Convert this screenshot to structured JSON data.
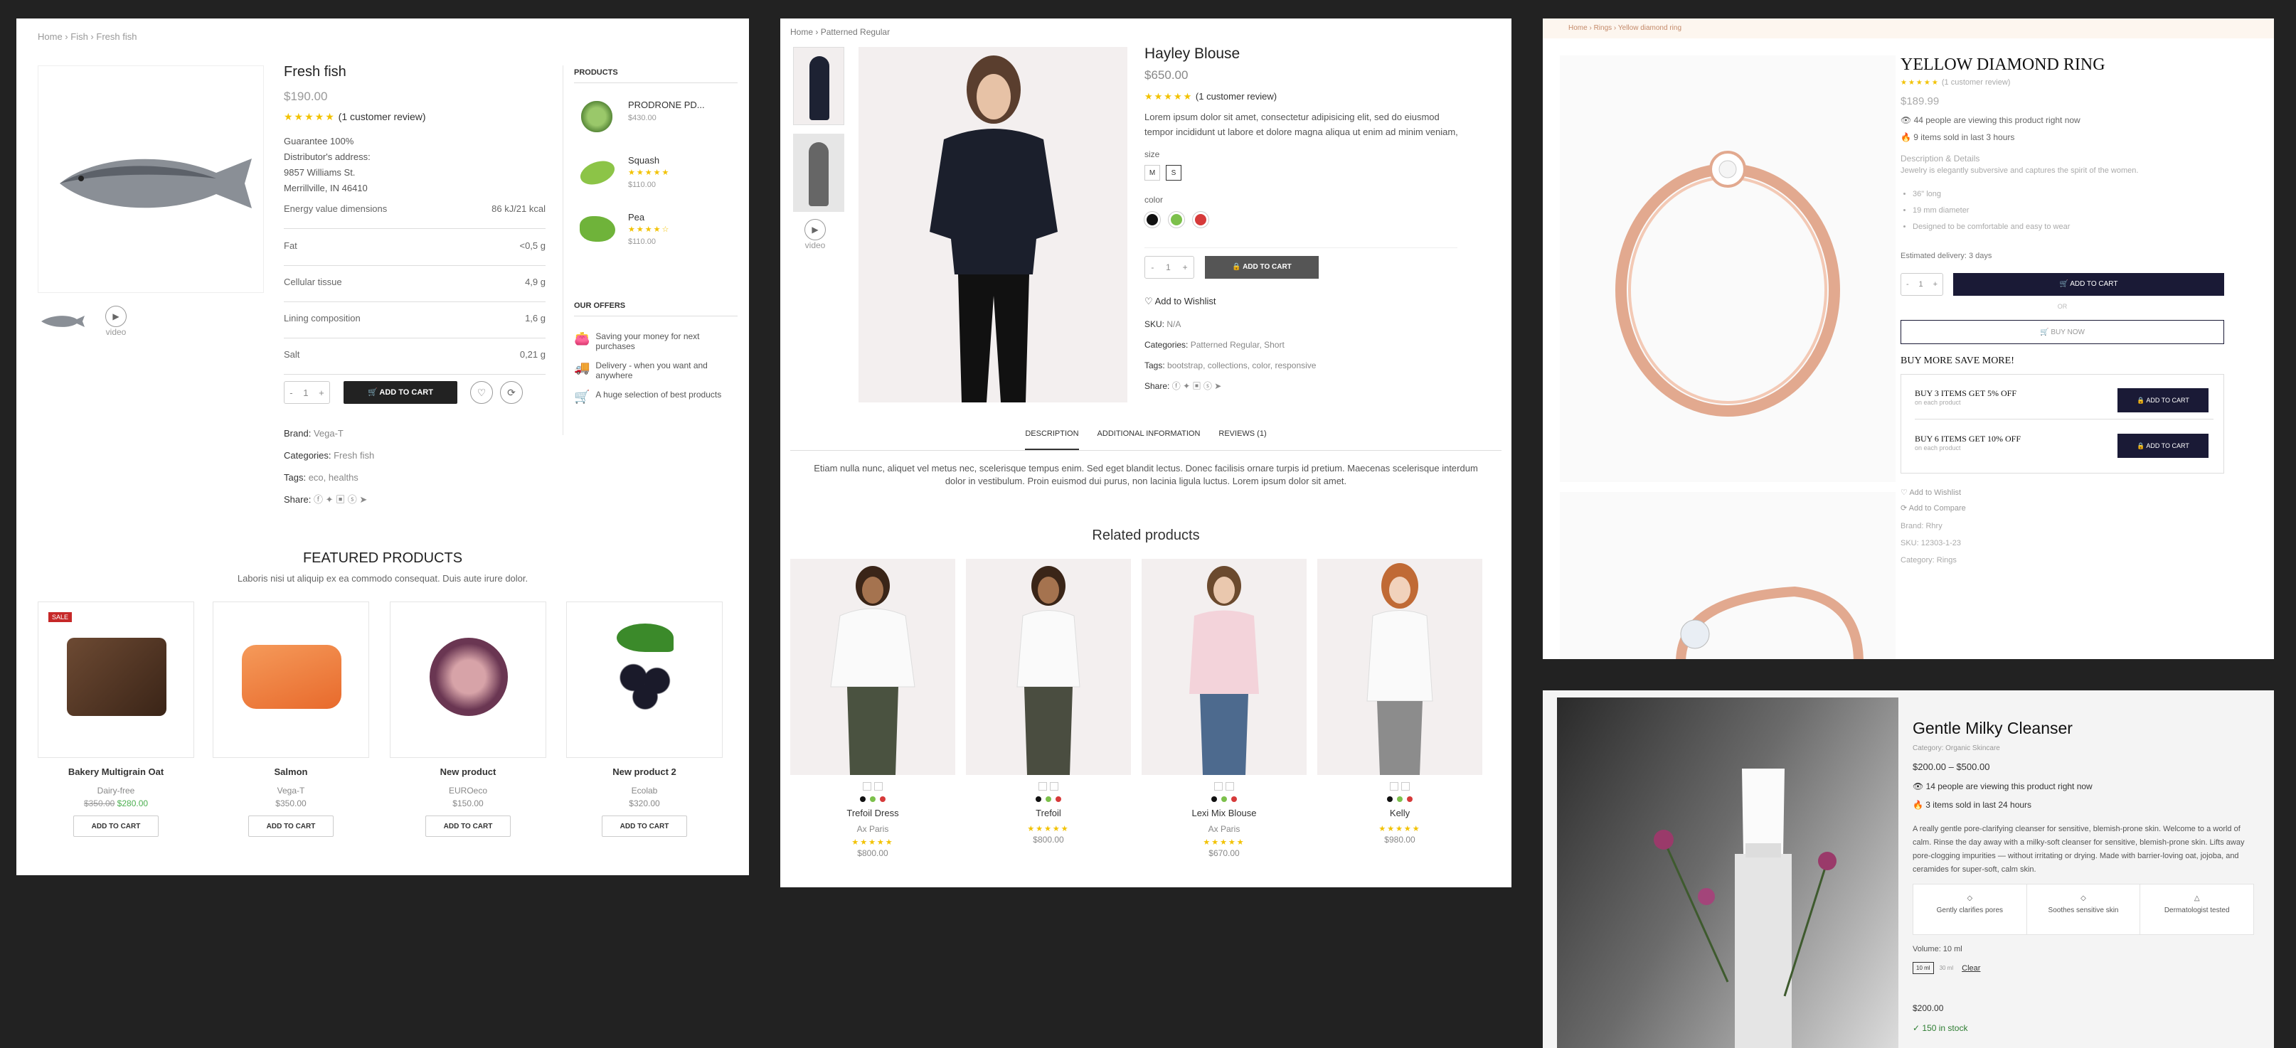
{
  "p1": {
    "breadcrumb": [
      "Home",
      "Fish",
      "Fresh fish"
    ],
    "title": "Fresh fish",
    "price": "$190.00",
    "stars": "★★★★★",
    "reviews": "(1 customer review)",
    "guarantee": "Guarantee 100%",
    "distributor": "Distributor's address:",
    "addr1": "9857 Williams St.",
    "addr2": "Merrillville, IN 46410",
    "nutrition": [
      {
        "k": "Energy value dimensions",
        "v": "86 kJ/21 kcal"
      },
      {
        "k": "Fat",
        "v": "<0,5 g"
      },
      {
        "k": "Cellular tissue",
        "v": "4,9 g"
      },
      {
        "k": "Lining composition",
        "v": "1,6 g"
      },
      {
        "k": "Salt",
        "v": "0,21 g"
      }
    ],
    "qty": "1",
    "add_to_cart": "ADD TO CART",
    "video": "video",
    "brand_k": "Brand:",
    "brand_v": "Vega-T",
    "cat_k": "Categories:",
    "cat_v": "Fresh fish",
    "tags_k": "Tags:",
    "tags_v": "eco, healths",
    "share": "Share:",
    "products_title": "PRODUCTS",
    "side_products": [
      {
        "name": "PRODRONE PD...",
        "price": "$430.00",
        "stars": ""
      },
      {
        "name": "Squash",
        "price": "$110.00",
        "stars": "★★★★★"
      },
      {
        "name": "Pea",
        "price": "$110.00",
        "stars": "★★★★☆"
      }
    ],
    "offers_title": "OUR OFFERS",
    "offers": [
      "Saving your money for next purchases",
      "Delivery - when you want and anywhere",
      "A huge selection of best products"
    ],
    "featured_title": "FEATURED PRODUCTS",
    "featured_sub": "Laboris nisi ut aliquip ex ea commodo consequat. Duis aute irure dolor.",
    "sale": "SALE",
    "featured": [
      {
        "name": "Bakery Multigrain Oat",
        "brand": "Dairy-free",
        "old": "$350.00",
        "price": "$280.00",
        "btn": "ADD TO CART"
      },
      {
        "name": "Salmon",
        "brand": "Vega-T",
        "old": "",
        "price": "$350.00",
        "btn": "ADD TO CART"
      },
      {
        "name": "New product",
        "brand": "EUROeco",
        "old": "",
        "price": "$150.00",
        "btn": "ADD TO CART"
      },
      {
        "name": "New product 2",
        "brand": "Ecolab",
        "old": "",
        "price": "$320.00",
        "btn": "ADD TO CART"
      }
    ]
  },
  "p2": {
    "breadcrumb": [
      "Home",
      "Patterned Regular"
    ],
    "title": "Hayley Blouse",
    "price": "$650.00",
    "stars": "★★★★★",
    "reviews": "(1 customer review)",
    "desc": "Lorem ipsum dolor sit amet, consectetur adipisicing elit, sed do eiusmod tempor incididunt ut labore et dolore magna aliqua ut enim ad minim veniam, quis nostrud exercitation ullamco laboris nisi ut aliquip ex ea commodo consequat. Duis aute irure dolor in reprehenderit in voluptate velit esse cillum dolore eu fugiat nulla pariatur. Excepteur sint occaecat cupidatat non proident, sunt in culpa qui officia deserunt mollit anim id est laborum.",
    "size_label": "size",
    "sizes": [
      "M",
      "S"
    ],
    "color_label": "color",
    "colors": [
      "#111111",
      "#7cc04b",
      "#d63a3a"
    ],
    "qty": "1",
    "add_to_cart": "ADD TO CART",
    "wishlist": "Add to Wishlist",
    "sku_k": "SKU:",
    "sku_v": "N/A",
    "cat_k": "Categories:",
    "cat_v": "Patterned Regular, Short",
    "tags_k": "Tags:",
    "tags_v": "bootstrap, collections, color, responsive",
    "share": "Share:",
    "video": "video",
    "tabs": [
      "DESCRIPTION",
      "ADDITIONAL INFORMATION",
      "REVIEWS (1)"
    ],
    "tab_text": "Etiam nulla nunc, aliquet vel metus nec, scelerisque tempus enim. Sed eget blandit lectus. Donec facilisis ornare turpis id pretium. Maecenas scelerisque interdum dolor in vestibulum. Proin euismod dui purus, non lacinia ligula luctus. Lorem ipsum dolor sit amet.",
    "related_title": "Related products",
    "related": [
      {
        "name": "Trefoil Dress",
        "brand": "Ax Paris",
        "price": "$800.00"
      },
      {
        "name": "Trefoil",
        "brand": "",
        "price": "$800.00"
      },
      {
        "name": "Lexi Mix Blouse",
        "brand": "Ax Paris",
        "price": "$670.00"
      },
      {
        "name": "Kelly",
        "brand": "",
        "price": "$980.00"
      }
    ]
  },
  "p3": {
    "breadcrumb": [
      "Home",
      "Rings",
      "Yellow diamond ring"
    ],
    "title": "YELLOW DIAMOND RING",
    "reviews": "(1 customer review)",
    "price": "$189.99",
    "viewing": "44 people are viewing this product right now",
    "sold": "9 items sold in last 3 hours",
    "desc_title": "Description & Details",
    "desc": "Jewelry is elegantly subversive and captures the spirit of the women.",
    "bullets": [
      "36\" long",
      "19 mm diameter",
      "Designed to be comfortable and easy to wear"
    ],
    "delivery": "Estimated delivery: 3 days",
    "qty": "1",
    "add_to_cart": "ADD TO CART",
    "or": "OR",
    "buy_now": "BUY NOW",
    "buy_more": "BUY MORE SAVE MORE!",
    "bundles": [
      {
        "title": "BUY 3 ITEMS GET 5% OFF",
        "sub": "on each product",
        "btn": "ADD TO CART"
      },
      {
        "title": "BUY 6 ITEMS GET 10% OFF",
        "sub": "on each product",
        "btn": "ADD TO CART"
      }
    ],
    "wishlist": "Add to Wishlist",
    "compare": "Add to Compare",
    "brand": "Brand: Rhry",
    "sku": "SKU: 12303-1-23",
    "category": "Category: Rings"
  },
  "p4": {
    "title": "Gentle Milky Cleanser",
    "category": "Category: Organic Skincare",
    "price_range": "$200.00 – $500.00",
    "viewing": "14 people are viewing this product right now",
    "sold": "3 items sold in last 24 hours",
    "desc": "A really gentle pore-clarifying cleanser for sensitive, blemish-prone skin. Welcome to a world of calm. Rinse the day away with a milky-soft cleanser for sensitive, blemish-prone skin. Lifts away pore-clogging impurities — without irritating or drying. Made with barrier-loving oat, jojoba, and ceramides for super-soft, calm skin.",
    "features": [
      "Gently clarifies pores",
      "Soothes sensitive skin",
      "Dermatologist tested"
    ],
    "volume": "Volume: 10 ml",
    "vol_opts": [
      "10 ml",
      "30 ml"
    ],
    "clear": "Clear",
    "price": "$200.00",
    "stock": "150 in stock"
  }
}
